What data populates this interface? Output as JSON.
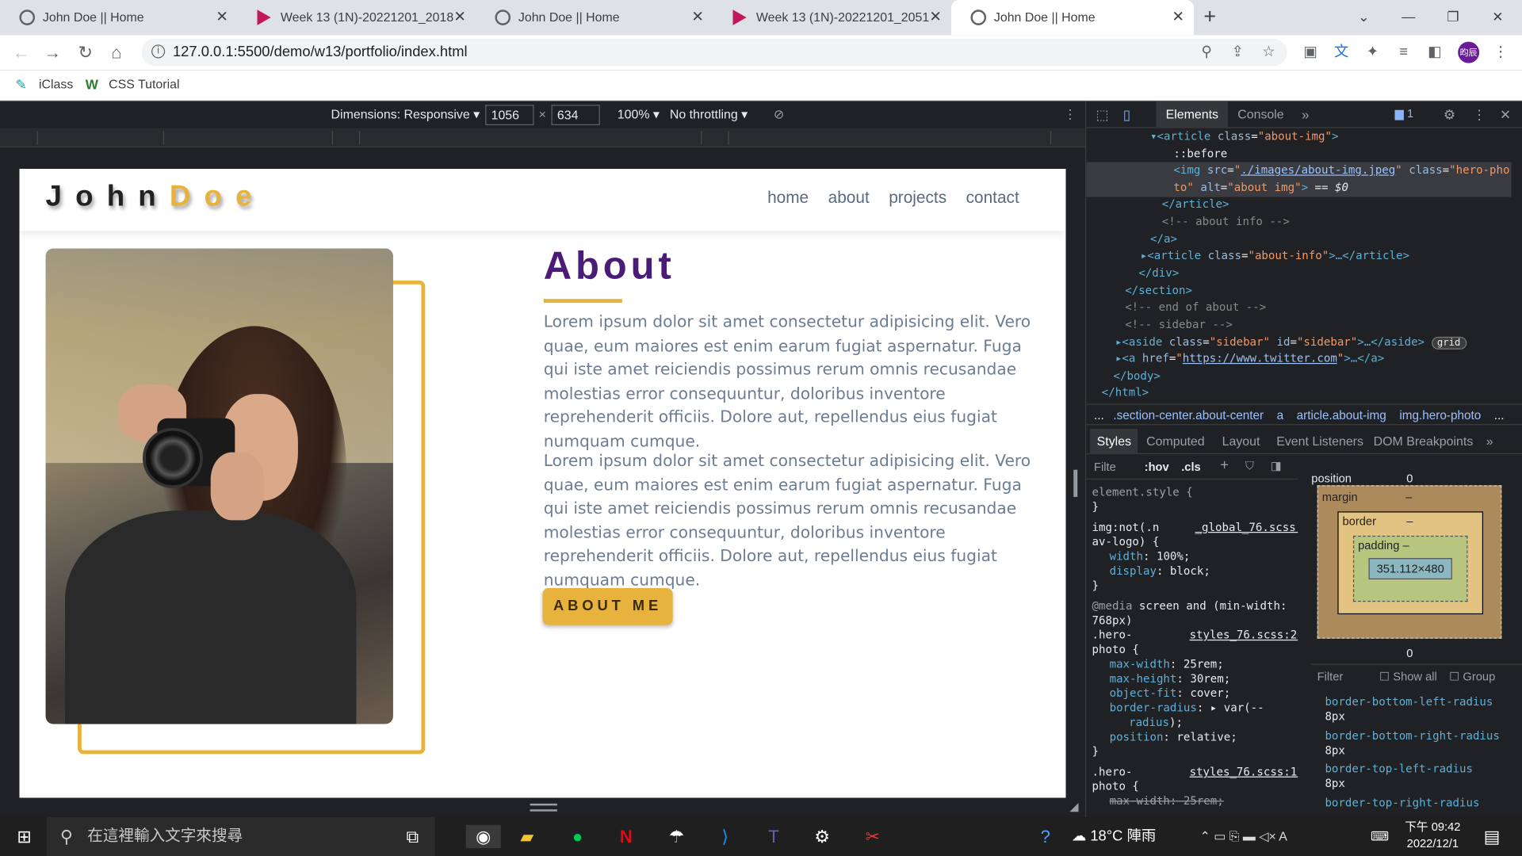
{
  "browser": {
    "tabs": [
      {
        "title": "John Doe || Home",
        "icon": "globe-icon"
      },
      {
        "title": "Week 13 (1N)-20221201_2018",
        "icon": "youtube-icon"
      },
      {
        "title": "John Doe || Home",
        "icon": "globe-icon"
      },
      {
        "title": "Week 13 (1N)-20221201_2051",
        "icon": "youtube-icon"
      },
      {
        "title": "John Doe || Home",
        "icon": "globe-icon"
      }
    ],
    "url": "127.0.0.1:5500/demo/w13/portfolio/index.html",
    "bookmarks": [
      "iClass",
      "CSS Tutorial"
    ],
    "avatar_text": "昀辰"
  },
  "device_toolbar": {
    "dimensions": "Dimensions: Responsive",
    "width": "1056",
    "height": "634",
    "zoom": "100%",
    "throttling": "No throttling"
  },
  "page": {
    "logo_first": "John",
    "logo_second": "Doe",
    "nav": [
      "home",
      "about",
      "projects",
      "contact"
    ],
    "title": "About",
    "paragraphs": [
      "Lorem ipsum dolor sit amet consectetur adipisicing elit. Vero quae, eum maiores est enim earum fugiat aspernatur. Fuga qui iste amet reiciendis possimus rerum omnis recusandae molestias error consequuntur, doloribus inventore reprehenderit officiis. Dolore aut, repellendus eius fugiat numquam cumque.",
      "Lorem ipsum dolor sit amet consectetur adipisicing elit. Vero quae, eum maiores est enim earum fugiat aspernatur. Fuga qui iste amet reiciendis possimus rerum omnis recusandae molestias error consequuntur, doloribus inventore reprehenderit officiis. Dolore aut, repellendus eius fugiat numquam cumque."
    ],
    "button": "ABOUT ME"
  },
  "devtools": {
    "tabs": [
      "Elements",
      "Console"
    ],
    "issues_count": "1",
    "breadcrumbs": [
      "...",
      ".section-center.about-center",
      "a",
      "article.about-img",
      "img.hero-photo",
      "..."
    ],
    "subtabs": [
      "Styles",
      "Computed",
      "Layout",
      "Event Listeners",
      "DOM Breakpoints"
    ],
    "filter_placeholder": "Filte",
    "hov": ":hov",
    "cls": ".cls",
    "box": {
      "position_label": "position",
      "position_value": "0",
      "margin": "margin",
      "border": "border",
      "padding": "padding",
      "content": "351.112×480",
      "dash": "–",
      "bottom_value": "0"
    },
    "computed_filter": "Filter",
    "show_all": "Show all",
    "group": "Group",
    "computed": [
      {
        "prop": "border-bottom-left-radius",
        "value": "8px"
      },
      {
        "prop": "border-bottom-right-radius",
        "value": "8px"
      },
      {
        "prop": "border-top-left-radius",
        "value": "8px"
      },
      {
        "prop": "border-top-right-radius",
        "value": ""
      }
    ]
  },
  "taskbar": {
    "search_placeholder": "在這裡輸入文字來搜尋",
    "weather": "18°C 陣雨",
    "time": "下午 09:42",
    "date": "2022/12/1"
  }
}
